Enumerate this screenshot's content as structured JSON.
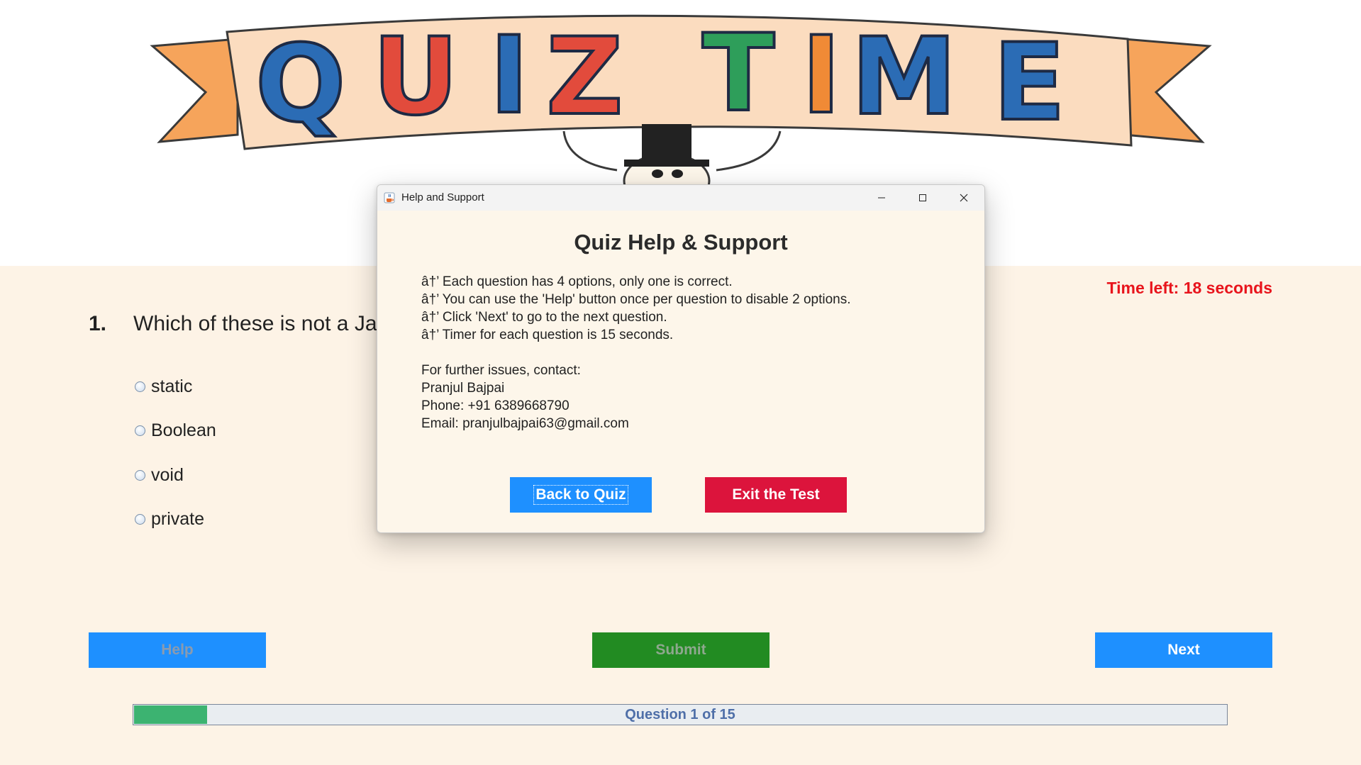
{
  "banner": {
    "letters": [
      "Q",
      "U",
      "I",
      "Z",
      "T",
      "I",
      "M",
      "E"
    ],
    "letter_colors": [
      "#2b6cb5",
      "#e24b3c",
      "#2b6cb5",
      "#e24b3c",
      "#2e9e5a",
      "#f08a36",
      "#2b6cb5",
      "#2b6cb5"
    ],
    "ribbon_color": "#fbdcbf",
    "ribbon_tail_color": "#f6a45b"
  },
  "question": {
    "number": "1.",
    "text": "Which of these is not a Ja",
    "options": [
      "static",
      "Boolean",
      "void",
      "private"
    ]
  },
  "timer": {
    "text": "Time left: 18 seconds",
    "color": "#e8141c"
  },
  "buttons": {
    "help": "Help",
    "submit": "Submit",
    "next": "Next"
  },
  "progress": {
    "label": "Question 1 of 15",
    "current": 1,
    "total": 15
  },
  "dialog": {
    "window_title": "Help and Support",
    "heading": "Quiz Help & Support",
    "lines": [
      "â†’ Each question has 4 options, only one is correct.",
      "â†’ You can use the 'Help' button once per question to disable 2 options.",
      "â†’ Click 'Next' to go to the next question.",
      "â†’ Timer for each question is 15 seconds.",
      "For further issues, contact:",
      "Pranjul Bajpai",
      "Phone: +91 6389668790",
      "Email: pranjulbajpai63@gmail.com"
    ],
    "back_label": "Back to Quiz",
    "exit_label": "Exit the Test",
    "icons": {
      "app": "java-cup-icon",
      "minimize": "minimize-icon",
      "maximize": "maximize-icon",
      "close": "close-icon"
    }
  },
  "colors": {
    "panel_bg": "#fdf3e6",
    "primary_blue": "#1e90ff",
    "submit_green": "#228b22",
    "exit_red": "#dc143c",
    "progress_green": "#3cb371"
  }
}
